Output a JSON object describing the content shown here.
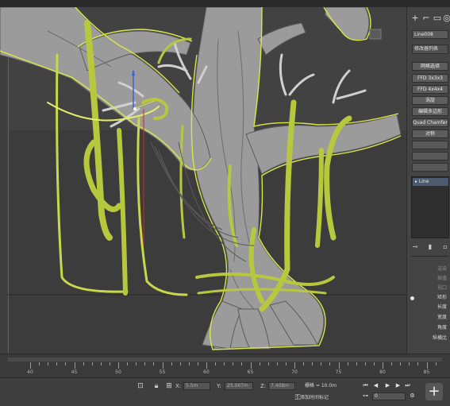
{
  "command_panel": {
    "tabs": [
      "+",
      "modify",
      "hierarchy",
      "motion"
    ],
    "object_name": "Line008",
    "modifier_list": "修改器列表",
    "buttons": [
      "网格选择",
      "FFD 3x3x3",
      "FFD 4x4x4",
      "涡旋",
      "编辑多边形",
      "Quad Chamfer",
      "对称"
    ],
    "stack_item": "Line",
    "params": {
      "rendering": "渲染",
      "interp": "插值",
      "viewport": "视口",
      "rect": "矩形",
      "length": "长度",
      "width": "宽度",
      "angle": "角度",
      "aspect": "纵横比"
    }
  },
  "timeline": {
    "ticks": [
      "40",
      "45",
      "50",
      "55",
      "60",
      "65",
      "70",
      "75",
      "80",
      "85"
    ]
  },
  "status": {
    "x_label": "X:",
    "x_value": "5.5m",
    "y_label": "Y:",
    "y_value": "25.067m",
    "z_label": "Z:",
    "z_value": "7.408m",
    "grid": "栅格 = 10.0m",
    "add_time_tag": "添加时间标记",
    "frame": "0"
  },
  "icons": {
    "select": "select-region-icon",
    "lock": "lock-icon",
    "transform": "transform-icon",
    "key": "key-icon"
  },
  "colors": {
    "accent_yellow": "#d8e84a",
    "spline_green": "#a9b83b",
    "tree_gray": "#9a9a9a",
    "viewport_bg": "#424242"
  }
}
